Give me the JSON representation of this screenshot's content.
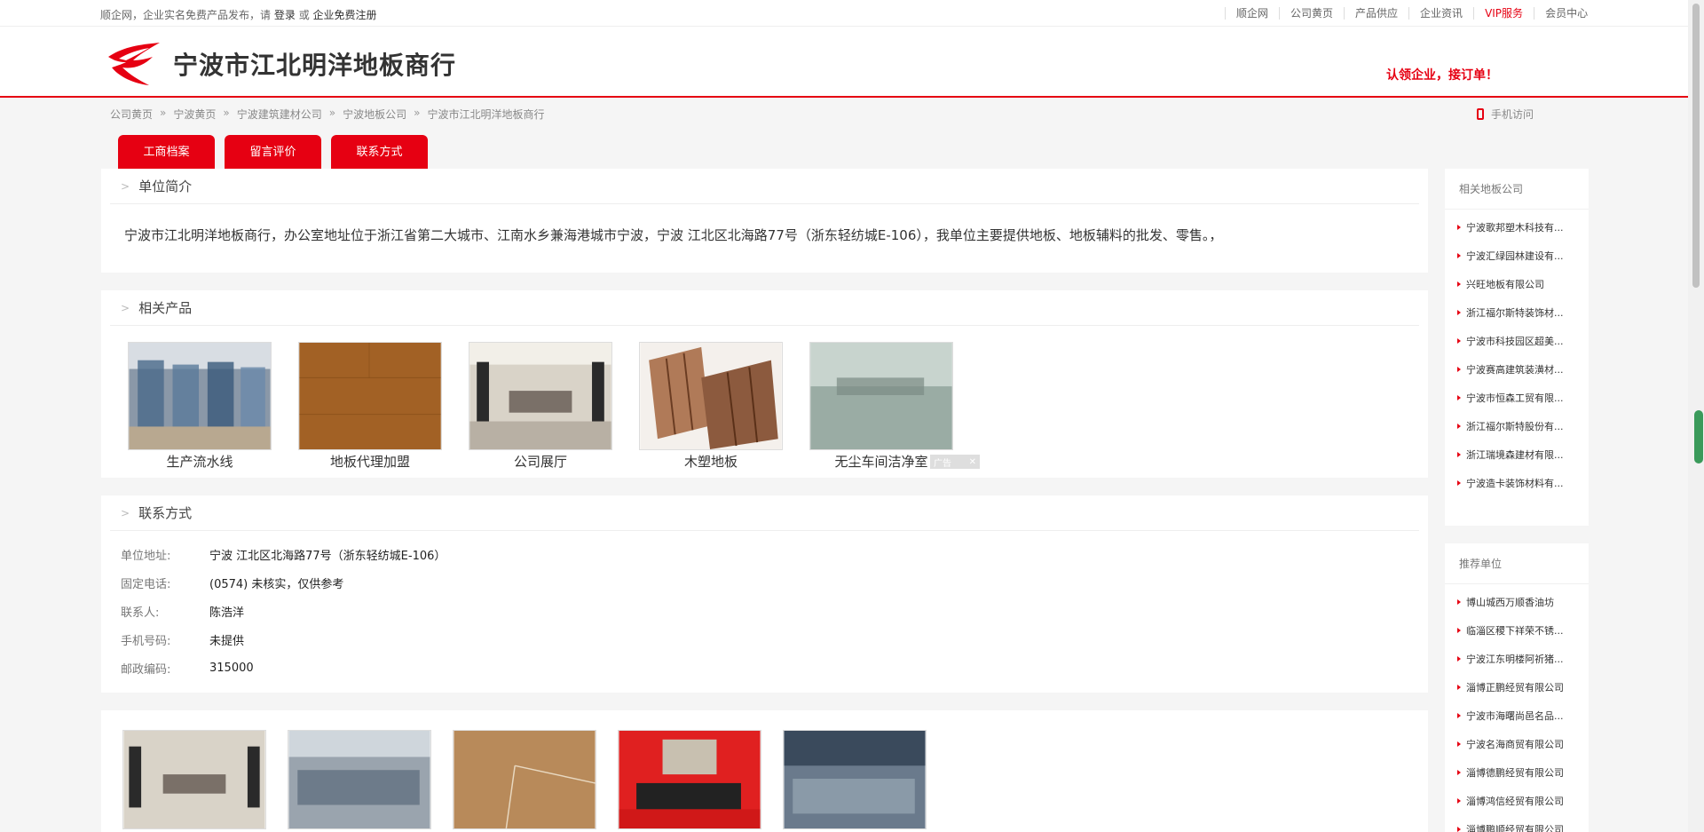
{
  "topbar": {
    "intro": "顺企网，企业实名免费产品发布，请",
    "login": "登录",
    "or": "或",
    "register": "企业免费注册",
    "links": [
      "顺企网",
      "公司黄页",
      "产品供应",
      "企业资讯",
      "VIP服务",
      "会员中心"
    ]
  },
  "header": {
    "site_name": "宁波市江北明洋地板商行",
    "slogan": "认领企业，接订单！"
  },
  "breadcrumb": [
    "公司黄页",
    "宁波黄页",
    "宁波建筑建材公司",
    "宁波地板公司",
    "宁波市江北明洋地板商行"
  ],
  "mobile_label": "手机访问",
  "tabs": [
    "工商档案",
    "留言评价",
    "联系方式"
  ],
  "intro": {
    "title": "单位简介",
    "text": "宁波市江北明洋地板商行，办公室地址位于浙江省第二大城市、江南水乡兼海港城市宁波，宁波 江北区北海路77号（浙东轻纺城E-106），我单位主要提供地板、地板辅料的批发、零售。，"
  },
  "products": {
    "title": "相关产品",
    "items": [
      "生产流水线",
      "地板代理加盟",
      "公司展厅",
      "木塑地板",
      "无尘车间洁净室"
    ]
  },
  "ad_label": "广告",
  "contact": {
    "title": "联系方式",
    "rows": [
      {
        "label": "单位地址:",
        "value": "宁波 江北区北海路77号（浙东轻纺城E-106）"
      },
      {
        "label": "固定电话:",
        "value": "(0574) 未核实，仅供参考"
      },
      {
        "label": "联系人:",
        "value": "陈浩洋"
      },
      {
        "label": "手机号码:",
        "value": "未提供"
      },
      {
        "label": "邮政编码:",
        "value": "315000"
      }
    ]
  },
  "sidebar": {
    "related_title": "相关地板公司",
    "related": [
      "宁波歌邦塑木科技有...",
      "宁波汇绿园林建设有...",
      "兴旺地板有限公司",
      "浙江福尔斯特装饰材...",
      "宁波市科技园区超美...",
      "宁波赛高建筑装潢材...",
      "宁波市恒森工贸有限...",
      "浙江福尔斯特股份有...",
      "浙江瑞境森建材有限...",
      "宁波造卡装饰材料有..."
    ],
    "recommend_title": "推荐单位",
    "recommend": [
      "博山城西万顺香油坊",
      "临淄区稷下祥荣不锈...",
      "宁波江东明楼阿祈猪...",
      "淄博正鹏经贸有限公司",
      "宁波市海曙尚邑名品...",
      "宁波名海商贸有限公司",
      "淄博德鹏经贸有限公司",
      "淄博鸿信经贸有限公司",
      "淄博鹏顺经贸有限公司"
    ]
  },
  "colors": {
    "brand": "#e60012"
  }
}
